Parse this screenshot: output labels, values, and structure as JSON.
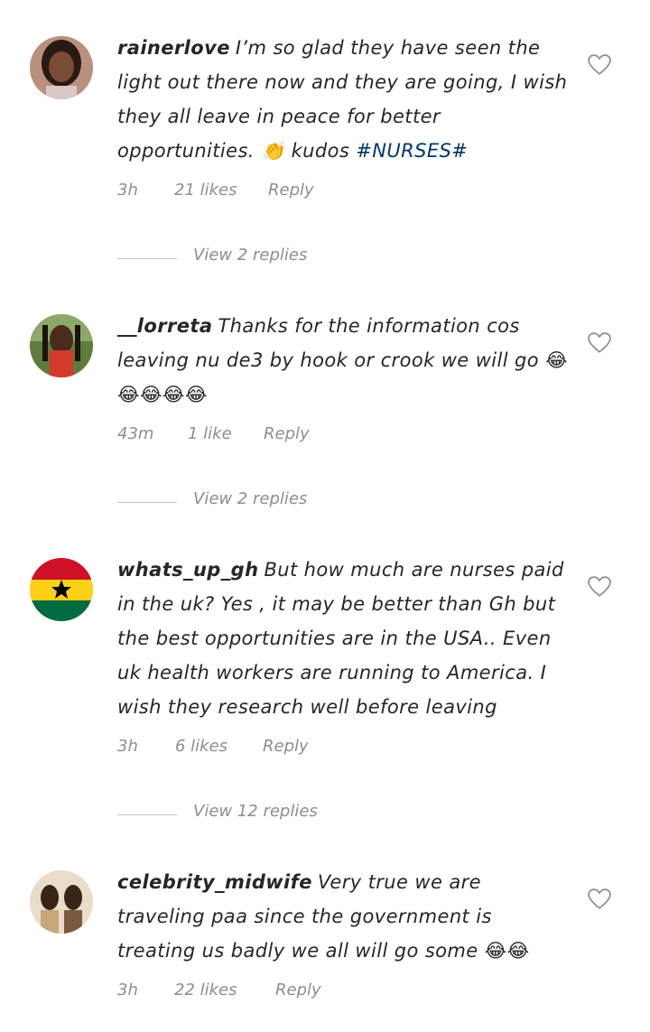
{
  "comments": [
    {
      "username": "rainerlove",
      "text": "I’m so glad they have seen the light out there now and they are going, I wish they all leave in peace for better opportunities. 👏 kudos",
      "hashtag": "#NURSES#",
      "time": "3h",
      "likes": "21 likes",
      "reply": "Reply",
      "view_replies": "View 2 replies"
    },
    {
      "username": "__lorreta",
      "text": "Thanks for the information cos leaving nu de3 by hook or crook we will go 😂😂😂😂😂",
      "time": "43m",
      "likes": "1 like",
      "reply": "Reply",
      "view_replies": "View 2 replies"
    },
    {
      "username": "whats_up_gh",
      "text": "But how much are nurses paid in the uk? Yes , it may be better  than Gh but the best opportunities are in the USA.. Even uk health workers are running to America. I wish they research well before leaving",
      "time": "3h",
      "likes": "6 likes",
      "reply": "Reply",
      "view_replies": "View 12 replies"
    },
    {
      "username": "celebrity_midwife",
      "text": "Very true we are traveling paa since the government is treating us badly we all will go some 😂😂",
      "time": "3h",
      "likes": "22 likes",
      "reply": "Reply"
    }
  ],
  "icons": {
    "heart": "heart-outline-icon",
    "flag": "ghana-flag"
  },
  "colors": {
    "text": "#262626",
    "secondary": "#8e8e8e",
    "hashtag": "#00376b"
  }
}
